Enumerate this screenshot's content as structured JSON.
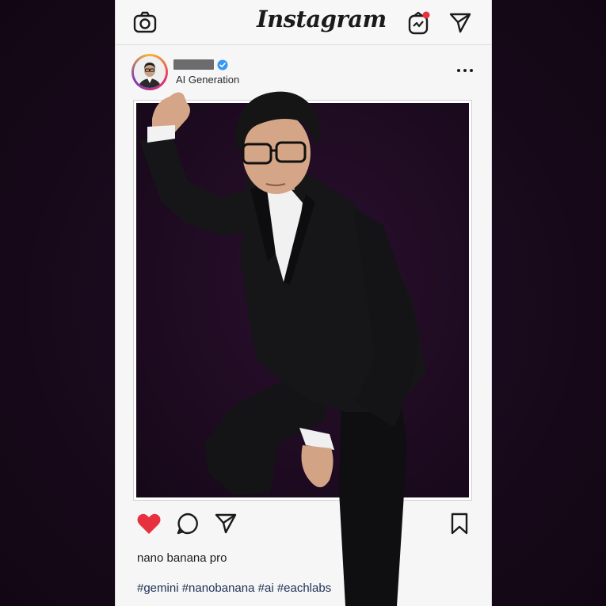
{
  "app": {
    "logo": "Instagram"
  },
  "post": {
    "subtitle": "AI Generation",
    "caption": "nano banana pro",
    "hashtags": "#gemini #nanobanana #ai #eachlabs"
  },
  "icons": {
    "camera": "camera-icon",
    "igtv": "igtv-icon",
    "direct": "direct-message-icon",
    "verified": "verified-badge-icon",
    "more": "more-options-icon",
    "like": "heart-icon",
    "comment": "comment-icon",
    "share": "share-icon",
    "save": "bookmark-icon"
  },
  "colors": {
    "background": "#160818",
    "card": "#f6f6f7",
    "like_active": "#e8313f",
    "verified": "#3897f0",
    "notification_dot": "#e8313f"
  },
  "state": {
    "liked": true
  }
}
